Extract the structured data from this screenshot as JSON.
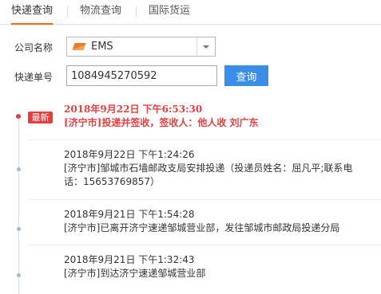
{
  "tabs": [
    {
      "label": "快递查询",
      "active": true
    },
    {
      "label": "物流查询",
      "active": false
    },
    {
      "label": "国际货运",
      "active": false
    }
  ],
  "form": {
    "company_label": "公司名称",
    "company_value": "EMS",
    "company_logo_icon": "ems-logo-icon",
    "tracking_label": "快递单号",
    "tracking_value": "1084945270592",
    "query_button": "查询"
  },
  "timeline": {
    "latest_badge": "最新",
    "entries": [
      {
        "time": "2018年9月22日 下午6:53:30",
        "context": "[济宁市]投递并签收，签收人：他人收 刘广东",
        "latest": true
      },
      {
        "time": "2018年9月22日 下午1:24:26",
        "context": "[济宁市]邹城市石墙邮政支局安排投递（投递员姓名：屈凡平;联系电话：15653769857）",
        "latest": false
      },
      {
        "time": "2018年9月21日 下午1:54:28",
        "context": "[济宁市]已离开济宁速递邹城营业部，发往邹城市邮政局投递分局",
        "latest": false
      },
      {
        "time": "2018年9月21日 下午1:32:43",
        "context": "[济宁市]到达济宁速递邹城营业部",
        "latest": false
      }
    ]
  },
  "colors": {
    "accent": "#f60",
    "button": "#3a8ee6",
    "latest": "#e24040",
    "dot": "#9db8d8"
  }
}
